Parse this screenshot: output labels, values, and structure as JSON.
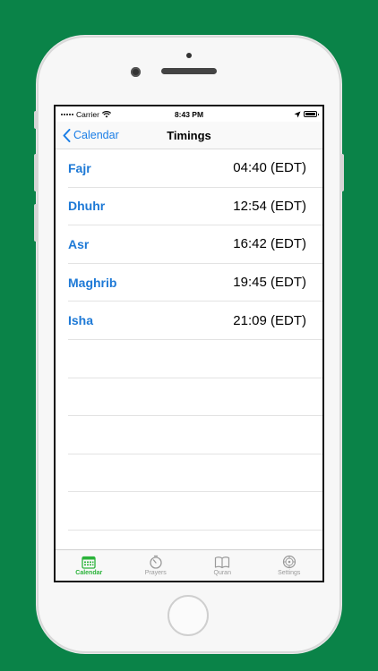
{
  "statusbar": {
    "carrier": "Carrier",
    "time": "8:43 PM"
  },
  "navbar": {
    "back_label": "Calendar",
    "title": "Timings"
  },
  "prayers": [
    {
      "name": "Fajr",
      "time": "04:40 (EDT)"
    },
    {
      "name": "Dhuhr",
      "time": "12:54 (EDT)"
    },
    {
      "name": "Asr",
      "time": "16:42 (EDT)"
    },
    {
      "name": "Maghrib",
      "time": "19:45 (EDT)"
    },
    {
      "name": "Isha",
      "time": "21:09 (EDT)"
    }
  ],
  "tabs": [
    {
      "label": "Calendar",
      "icon": "calendar-icon",
      "active": true
    },
    {
      "label": "Prayers",
      "icon": "stopwatch-icon",
      "active": false
    },
    {
      "label": "Quran",
      "icon": "book-icon",
      "active": false
    },
    {
      "label": "Settings",
      "icon": "gear-icon",
      "active": false
    }
  ],
  "colors": {
    "background": "#0a8348",
    "accent_blue": "#1a7ee6",
    "tab_active": "#2bb33a",
    "tab_inactive": "#9a9a9a"
  }
}
